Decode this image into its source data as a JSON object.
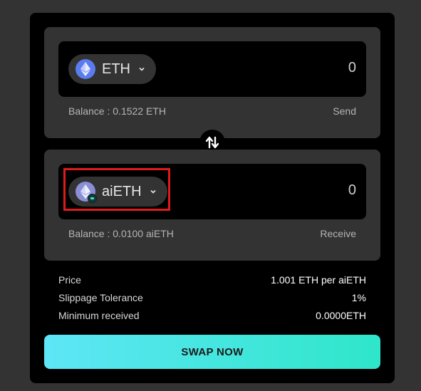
{
  "from": {
    "token": "ETH",
    "amount": "0",
    "balance": "Balance : 0.1522 ETH",
    "action": "Send",
    "icon": "eth-icon"
  },
  "to": {
    "token": "aiETH",
    "amount": "0",
    "balance": "Balance : 0.0100 aiETH",
    "action": "Receive",
    "icon": "aieth-icon"
  },
  "info": {
    "price_label": "Price",
    "price_value": "1.001 ETH per aiETH",
    "slippage_label": "Slippage Tolerance",
    "slippage_value": "1%",
    "min_label": "Minimum received",
    "min_value": "0.0000ETH"
  },
  "swap_label": "SWAP NOW",
  "colors": {
    "accent_start": "#5ee6f6",
    "accent_end": "#2ee6c9",
    "highlight": "#e01b1b"
  }
}
